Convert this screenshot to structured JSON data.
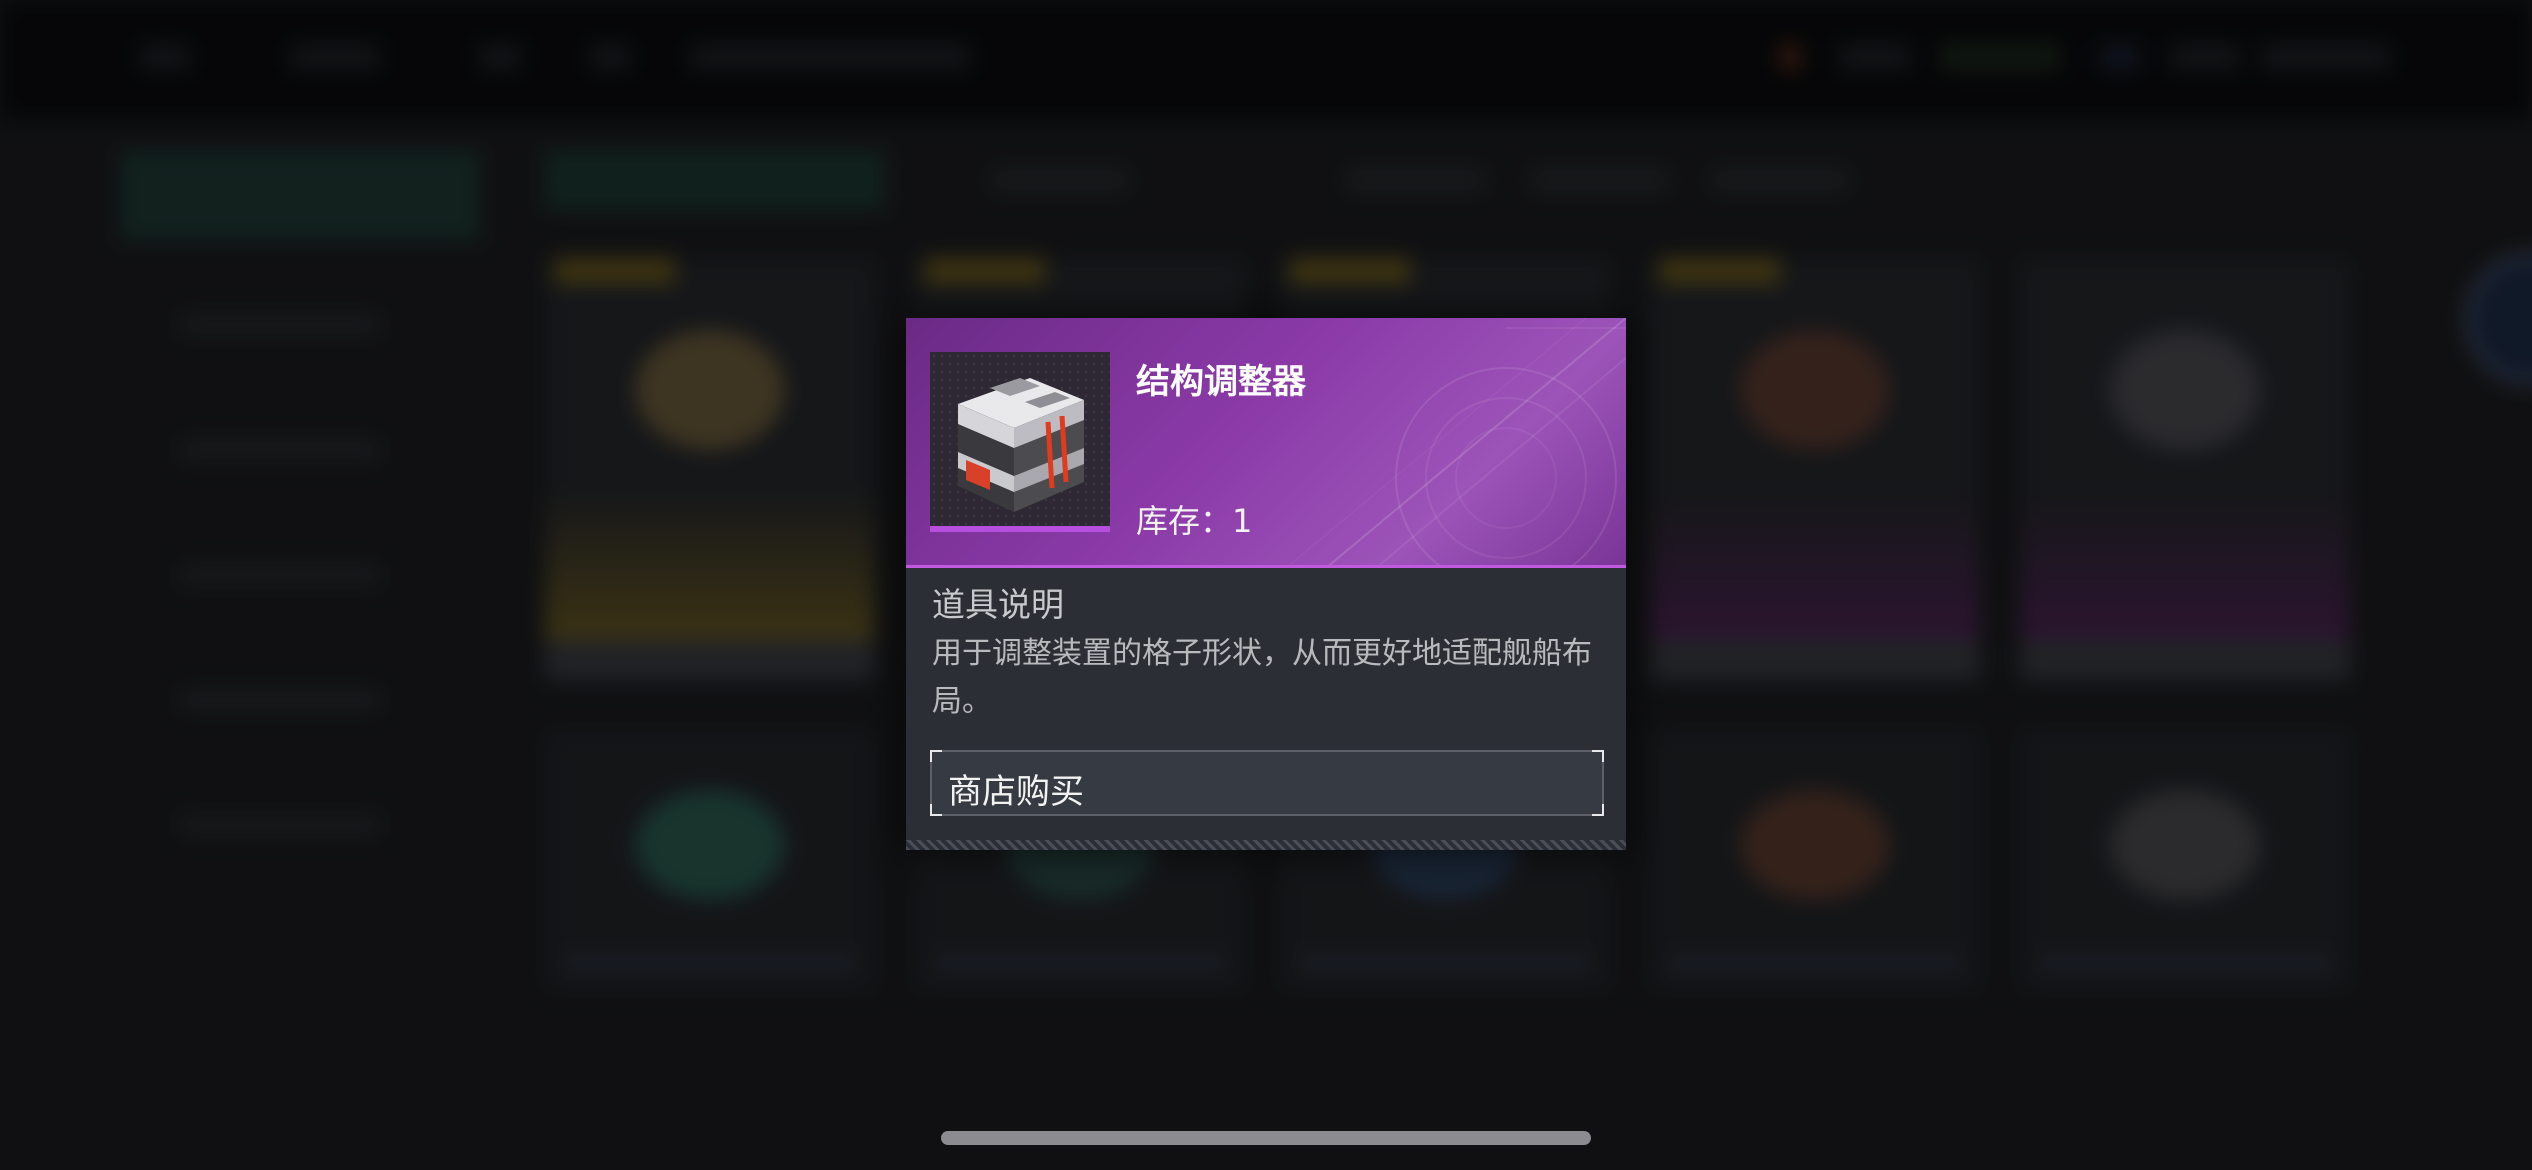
{
  "colors": {
    "header_purple": "#8b3aa8",
    "rarity_bar": "#b64fe0",
    "popup_body": "#2b2e34",
    "button_bg": "#363a42"
  },
  "item_popup": {
    "item_name": "结构调整器",
    "stock_label": "库存：",
    "stock_value": "1",
    "item_icon": "structure-adjuster-cube-icon",
    "description_title": "道具说明",
    "description_text": "用于调整装置的格子形状，从而更好地适配舰船布局。",
    "shop_button_label": "商店购买"
  }
}
